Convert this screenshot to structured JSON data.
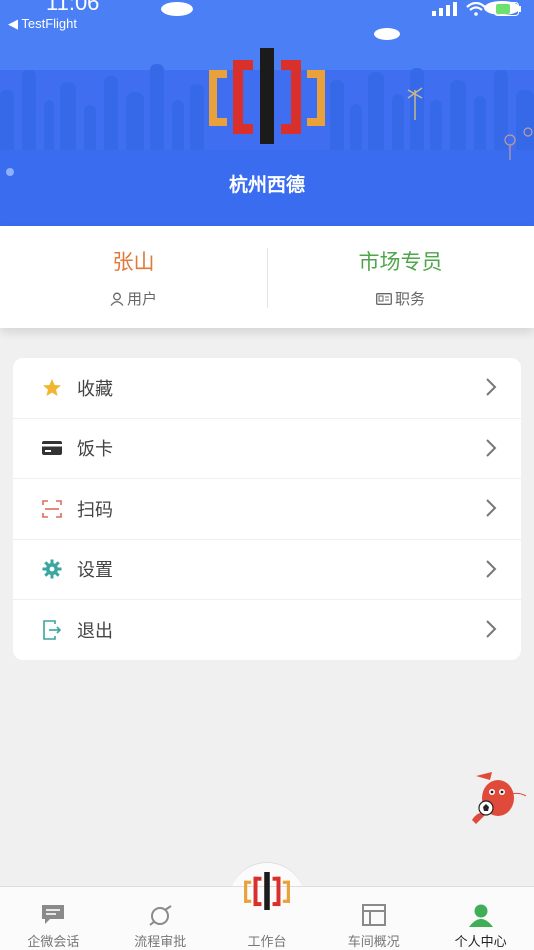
{
  "status_bar": {
    "time": "11:06",
    "back_app": "◀ TestFlight"
  },
  "header": {
    "company_name": "杭州西德",
    "bg_color": "#3d6ef0"
  },
  "profile": {
    "user_name": "张山",
    "user_label": "用户",
    "position": "市场专员",
    "position_label": "职务"
  },
  "menu": {
    "items": [
      {
        "label": "收藏",
        "icon": "star-icon",
        "color": "#f2b530"
      },
      {
        "label": "饭卡",
        "icon": "card-icon",
        "color": "#333333"
      },
      {
        "label": "扫码",
        "icon": "scan-icon",
        "color": "#e06a5a"
      },
      {
        "label": "设置",
        "icon": "gear-icon",
        "color": "#3aa6a0"
      },
      {
        "label": "退出",
        "icon": "logout-icon",
        "color": "#3aa6a0"
      }
    ]
  },
  "tabbar": {
    "tabs": [
      {
        "label": "企微会话",
        "icon": "chat-icon"
      },
      {
        "label": "流程审批",
        "icon": "approval-icon"
      },
      {
        "label": "工作台",
        "icon": "workbench-logo-icon"
      },
      {
        "label": "车间概况",
        "icon": "layout-icon"
      },
      {
        "label": "个人中心",
        "icon": "person-icon",
        "active": true
      }
    ]
  }
}
